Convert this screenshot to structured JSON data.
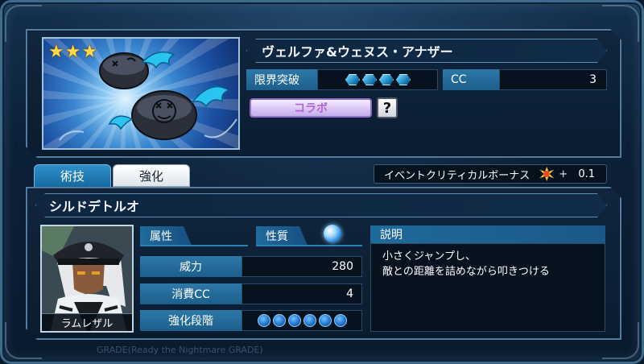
{
  "card": {
    "rarity_stars": 3,
    "star_glyph": "★"
  },
  "character_name": "ヴェルファ&ウェヌス・アナザー",
  "stats_top": {
    "limit_break_label": "限界突破",
    "limit_break_level": 4,
    "cc_label": "CC",
    "cc_value": "3"
  },
  "collab_button": "コラボ",
  "help_button": "?",
  "tabs": [
    {
      "label": "術技",
      "active": true
    },
    {
      "label": "強化",
      "active": false
    }
  ],
  "event_bonus": {
    "label": "イベントクリティカルボーナス",
    "plus": "+",
    "value": "0.1"
  },
  "skill": {
    "name": "シルドデトルオ",
    "portrait_name": "ラムレザル",
    "attribute_label": "属性",
    "nature_label": "性質",
    "power_label": "威力",
    "power_value": "280",
    "cost_label": "消費CC",
    "cost_value": "4",
    "level_label": "強化段階",
    "level_pips": 6,
    "desc_label": "説明",
    "desc_line1": "小さくジャンプし、",
    "desc_line2": "敵との距離を詰めながら叩きつける"
  },
  "copyright": "GRADE(Ready the Nightmare GRADE)",
  "colors": {
    "accent": "#2c79a8",
    "panel_border": "#4e7ea2",
    "collab": "#c5aeea",
    "star": "#ffd84a"
  }
}
